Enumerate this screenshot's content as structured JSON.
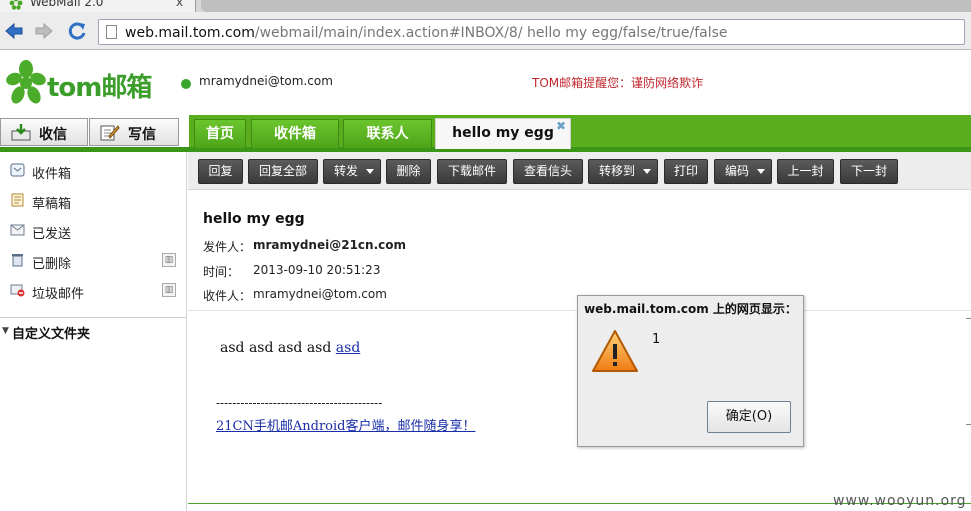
{
  "browser": {
    "tab_title": "WebMail 2.0",
    "tab_close": "x",
    "url_host": "web.mail.tom.com",
    "url_path": "/webmail/main/index.action#INBOX/8/ hello my egg/false/true/false"
  },
  "header": {
    "logo_text": "tom邮箱",
    "user_email": "mramydnei@tom.com",
    "notice": "TOM邮箱提醒您：谨防网络欺诈"
  },
  "actions": {
    "receive_label": "收信",
    "compose_label": "写信"
  },
  "tabs": [
    {
      "label": "首页"
    },
    {
      "label": "收件箱"
    },
    {
      "label": "联系人"
    },
    {
      "label": "hello my egg",
      "close": "✖"
    }
  ],
  "sidebar": {
    "items": [
      {
        "label": "收件箱"
      },
      {
        "label": "草稿箱"
      },
      {
        "label": "已发送"
      },
      {
        "label": "已删除"
      },
      {
        "label": "垃圾邮件"
      }
    ],
    "custom_folders_label": "自定义文件夹"
  },
  "toolbar": {
    "buttons": [
      {
        "label": "回复"
      },
      {
        "label": "回复全部"
      },
      {
        "label": "转发"
      },
      {
        "label": "删除"
      },
      {
        "label": "下载邮件"
      },
      {
        "label": "查看信头"
      },
      {
        "label": "转移到"
      },
      {
        "label": "打印"
      },
      {
        "label": "编码"
      },
      {
        "label": "上一封"
      },
      {
        "label": "下一封"
      }
    ]
  },
  "message": {
    "subject": "hello my egg",
    "from_label": "发件人：",
    "from_value": "mramydnei@21cn.com",
    "time_label": "时间：",
    "time_value": "2013-09-10 20:51:23",
    "to_label": "收件人：",
    "to_value": "mramydnei@tom.com",
    "body_text": "asd asd asd asd ",
    "body_link": "asd",
    "signature_line": "-----------------------------------------",
    "signature_link": "21CN手机邮Android客户端，邮件随身享！"
  },
  "dialog": {
    "title": "web.mail.tom.com 上的网页显示：",
    "message": "1",
    "ok_label": "确定(O)"
  },
  "watermark": "www.wooyun.org",
  "colors": {
    "brand_green": "#5aae1d",
    "notice_red": "#c0272d",
    "link_blue": "#1a2ea8"
  }
}
